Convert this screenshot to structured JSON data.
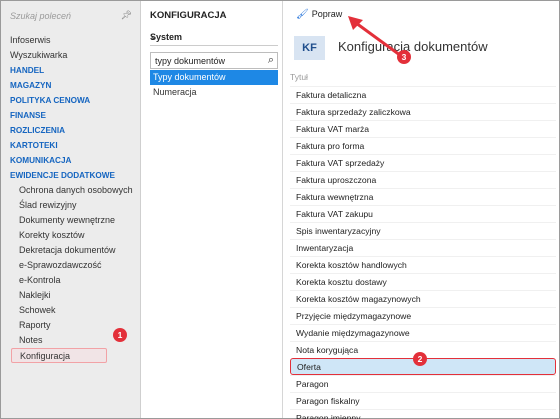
{
  "nav": {
    "search_placeholder": "Szukaj poleceń",
    "items": [
      {
        "label": "Infoserwis",
        "type": "item"
      },
      {
        "label": "Wyszukiwarka",
        "type": "item"
      },
      {
        "label": "HANDEL",
        "type": "group"
      },
      {
        "label": "MAGAZYN",
        "type": "group"
      },
      {
        "label": "POLITYKA CENOWA",
        "type": "group"
      },
      {
        "label": "FINANSE",
        "type": "group"
      },
      {
        "label": "ROZLICZENIA",
        "type": "group"
      },
      {
        "label": "KARTOTEKI",
        "type": "group"
      },
      {
        "label": "KOMUNIKACJA",
        "type": "group"
      },
      {
        "label": "EWIDENCJE DODATKOWE",
        "type": "group"
      },
      {
        "label": "Ochrona danych osobowych",
        "type": "sub"
      },
      {
        "label": "Ślad rewizyjny",
        "type": "sub"
      },
      {
        "label": "Dokumenty wewnętrzne",
        "type": "sub"
      },
      {
        "label": "Korekty kosztów",
        "type": "sub"
      },
      {
        "label": "Dekretacja dokumentów",
        "type": "sub"
      },
      {
        "label": "e-Sprawozdawczość",
        "type": "sub"
      },
      {
        "label": "e-Kontrola",
        "type": "sub"
      },
      {
        "label": "Naklejki",
        "type": "sub"
      },
      {
        "label": "Schowek",
        "type": "sub"
      },
      {
        "label": "Raporty",
        "type": "sub"
      },
      {
        "label": "Notes",
        "type": "sub"
      },
      {
        "label": "Konfiguracja",
        "type": "highlight"
      }
    ]
  },
  "middle": {
    "title": "KONFIGURACJA",
    "system_label": "System",
    "search_value": "typy dokumentów",
    "items": [
      "Typy dokumentów",
      "Numeracja"
    ]
  },
  "right": {
    "toolbar_popraw": "Popraw",
    "badge_text": "KF",
    "title": "Konfiguracja dokumentów",
    "column_header": "Tytuł",
    "rows": [
      "Faktura detaliczna",
      "Faktura sprzedaży zaliczkowa",
      "Faktura VAT marża",
      "Faktura pro forma",
      "Faktura VAT sprzedaży",
      "Faktura uproszczona",
      "Faktura wewnętrzna",
      "Faktura VAT zakupu",
      "Spis inwentaryzacyjny",
      "Inwentaryzacja",
      "Korekta kosztów handlowych",
      "Korekta kosztu dostawy",
      "Korekta kosztów magazynowych",
      "Przyjęcie międzymagazynowe",
      "Wydanie międzymagazynowe",
      "Nota korygująca",
      "Oferta",
      "Paragon",
      "Paragon fiskalny",
      "Paragon imienny"
    ],
    "selected_row": "Oferta"
  },
  "annotations": {
    "step1": "1",
    "step2": "2",
    "step3": "3",
    "color": "#e3303a"
  }
}
